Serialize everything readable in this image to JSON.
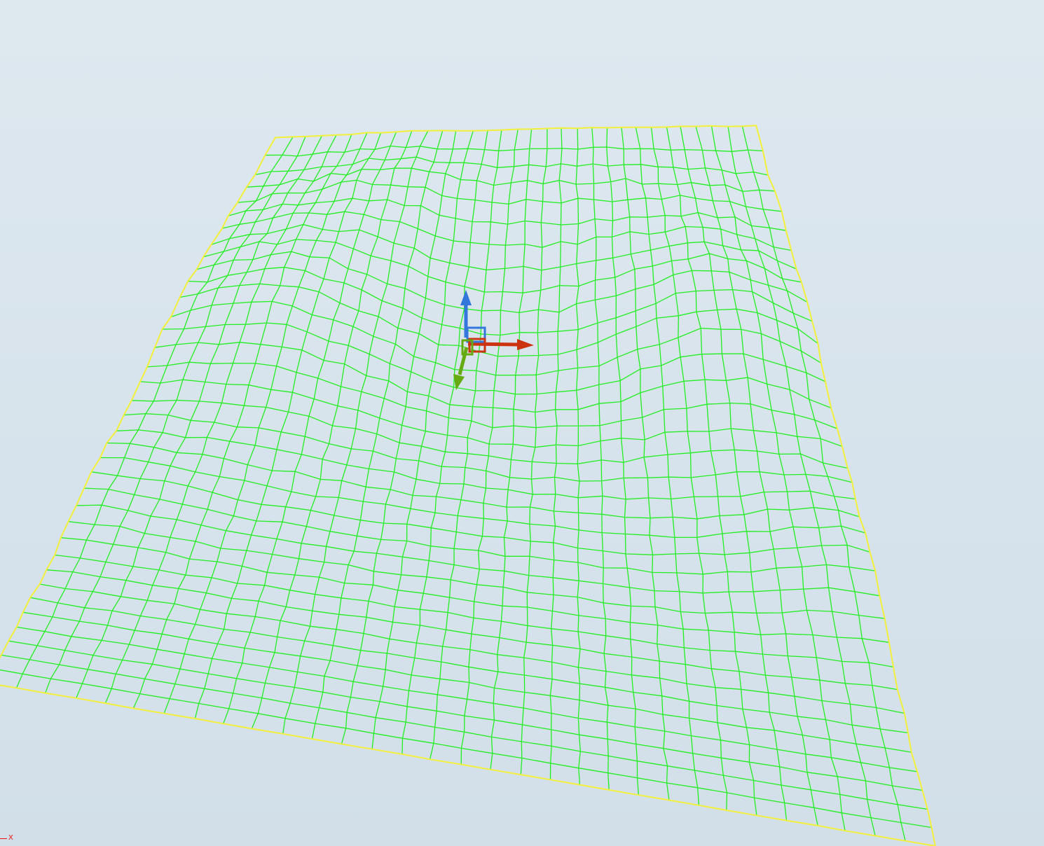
{
  "viewport": {
    "background_color": "#d9e5ee",
    "mesh": {
      "wire_color": "#22ee22",
      "boundary_color": "#f2f03a",
      "rows": 36,
      "columns": 32,
      "shape": "terrain heightfield wireframe"
    },
    "gizmo": {
      "x_axis_color": "#cc3311",
      "y_axis_color": "#66aa11",
      "z_axis_color": "#3377dd"
    },
    "axis_indicator": {
      "label": "X",
      "color": "#ee1111"
    }
  }
}
